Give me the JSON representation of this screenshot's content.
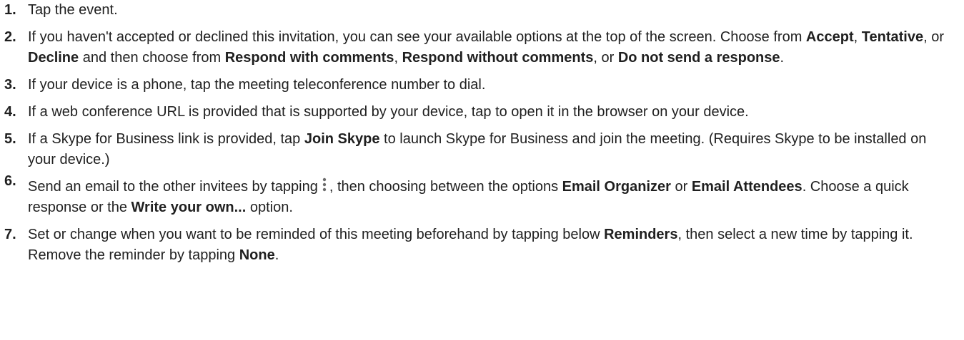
{
  "steps": [
    {
      "number": "1.",
      "parts": [
        {
          "t": "Tap the event.",
          "b": false
        }
      ]
    },
    {
      "number": "2.",
      "parts": [
        {
          "t": "If you haven't accepted or declined this invitation, you can see your available options at the top of the screen. Choose from  ",
          "b": false
        },
        {
          "t": "Accept",
          "b": true
        },
        {
          "t": ", ",
          "b": false
        },
        {
          "t": "Tentative",
          "b": true
        },
        {
          "t": ", or ",
          "b": false
        },
        {
          "t": "Decline",
          "b": true
        },
        {
          "t": " and then choose from ",
          "b": false
        },
        {
          "t": "Respond with comments",
          "b": true
        },
        {
          "t": ", ",
          "b": false
        },
        {
          "t": "Respond without comments",
          "b": true
        },
        {
          "t": ", or ",
          "b": false
        },
        {
          "t": "Do not send a response",
          "b": true
        },
        {
          "t": ".",
          "b": false
        }
      ]
    },
    {
      "number": "3.",
      "parts": [
        {
          "t": "If your device is a phone, tap the meeting teleconference number to dial.",
          "b": false
        }
      ]
    },
    {
      "number": "4.",
      "parts": [
        {
          "t": "If a web conference URL is provided that is supported by your device, tap to open it in the browser on your device.",
          "b": false
        }
      ]
    },
    {
      "number": "5.",
      "parts": [
        {
          "t": "If a Skype for Business link is provided, tap ",
          "b": false
        },
        {
          "t": "Join Skype",
          "b": true
        },
        {
          "t": " to launch Skype for Business and join the meeting. (Requires Skype to be installed on your device.)",
          "b": false
        }
      ]
    },
    {
      "number": "6.",
      "raised": true,
      "parts": [
        {
          "t": "Send an email to the other invitees by tapping",
          "b": false
        },
        {
          "icon": "kebab-menu-icon"
        },
        {
          "t": ", then choosing between the options ",
          "b": false
        },
        {
          "t": "Email Organizer",
          "b": true
        },
        {
          "t": " or ",
          "b": false
        },
        {
          "t": "Email Attendees",
          "b": true
        },
        {
          "t": ". Choose a quick response or the ",
          "b": false
        },
        {
          "t": "Write your own...",
          "b": true
        },
        {
          "t": " option.",
          "b": false
        }
      ]
    },
    {
      "number": "7.",
      "parts": [
        {
          "t": "Set or change when you want to be reminded of this meeting beforehand by tapping below ",
          "b": false
        },
        {
          "t": "Reminders",
          "b": true
        },
        {
          "t": ", then select a new time by tapping it. Remove the reminder by tapping ",
          "b": false
        },
        {
          "t": "None",
          "b": true
        },
        {
          "t": ".",
          "b": false
        }
      ]
    }
  ]
}
